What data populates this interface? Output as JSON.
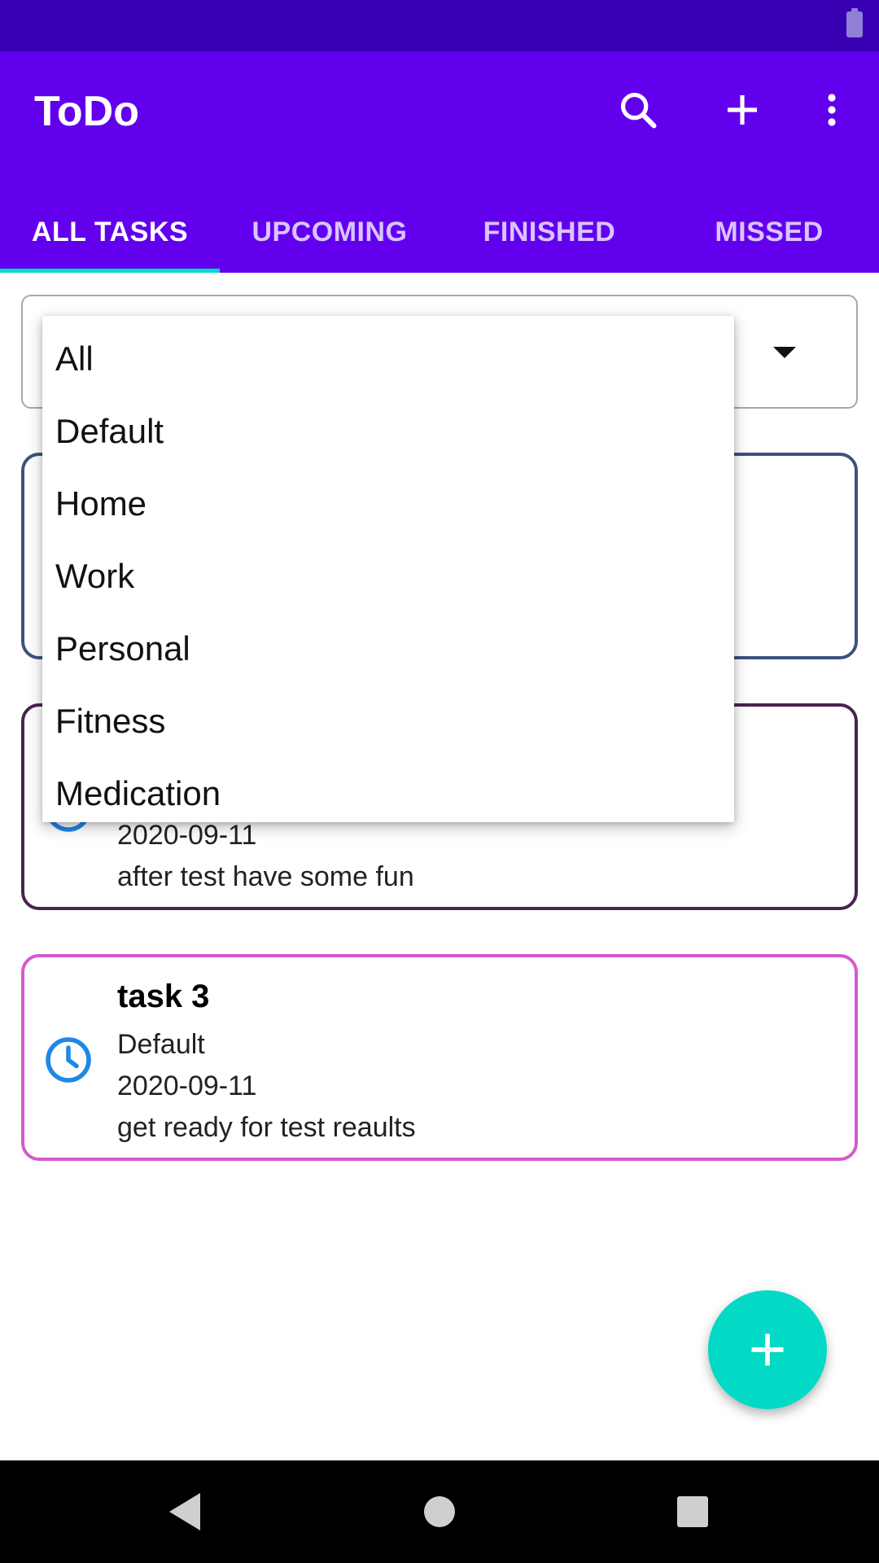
{
  "app": {
    "title": "ToDo"
  },
  "toolbar": {
    "search_icon": "search-icon",
    "add_icon": "plus-icon",
    "more_icon": "more-vertical-icon"
  },
  "tabs": [
    {
      "label": "ALL TASKS",
      "active": true
    },
    {
      "label": "UPCOMING",
      "active": false
    },
    {
      "label": "FINISHED",
      "active": false
    },
    {
      "label": "MISSED",
      "active": false
    }
  ],
  "category_filter": {
    "options": [
      "All",
      "Default",
      "Home",
      "Work",
      "Personal",
      "Fitness",
      "Medication"
    ]
  },
  "tasks": [
    {
      "title": "",
      "category": "",
      "date": "",
      "note": ""
    },
    {
      "title": "",
      "category": "",
      "date": "2020-09-11",
      "note": "after test have some fun"
    },
    {
      "title": "task 3",
      "category": "Default",
      "date": "2020-09-11",
      "note": "get ready for test reaults"
    }
  ],
  "colors": {
    "status_bar": "#3700b3",
    "app_bar": "#6200ee",
    "accent": "#03dac5",
    "clock_icon": "#1e88e5",
    "card1_border": "#3d5280",
    "card2_border": "#4a2350",
    "card3_border": "#d65acc"
  }
}
